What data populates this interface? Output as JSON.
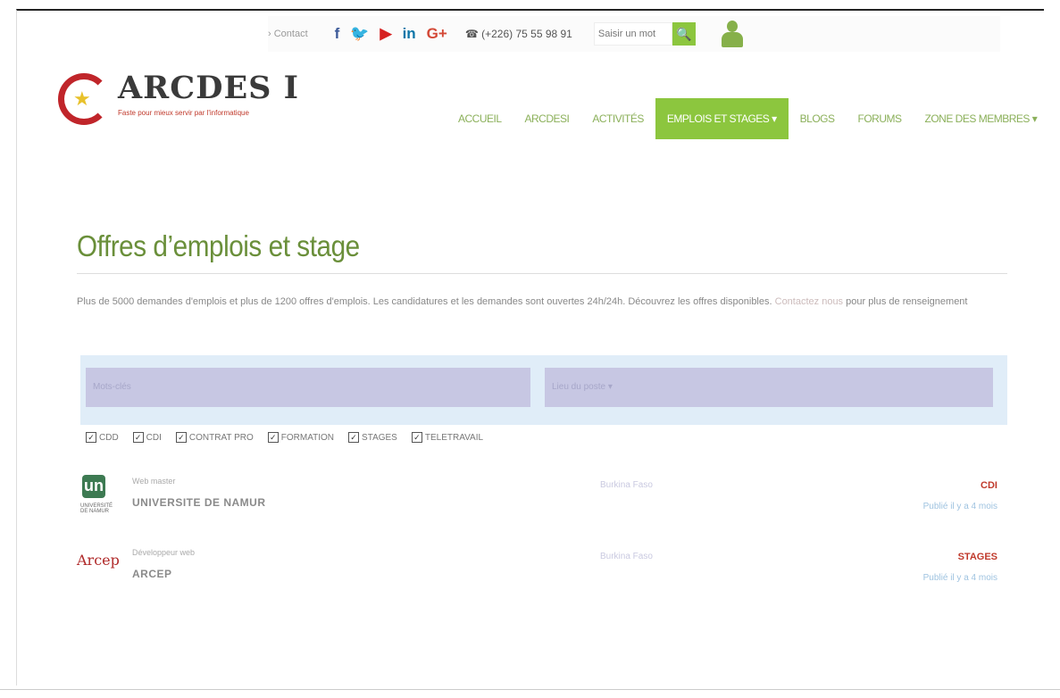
{
  "topbar": {
    "contact": "› Contact",
    "social": {
      "facebook": "f",
      "twitter": "✨",
      "youtube": "▶",
      "linkedin": "in",
      "googleplus": "G+"
    },
    "phone": "☎ (+226) 75 55 98 91",
    "search_placeholder": "Saisir un mot",
    "search_icon": "🔍"
  },
  "logo": {
    "title": "ARCDES I",
    "tagline": "Faste pour mieux servir par l'informatique"
  },
  "nav": {
    "items": [
      "ACCUEIL",
      "ARCDESI",
      "ACTIVITÉS",
      "EMPLOIS ET STAGES ▾",
      "BLOGS",
      "FORUMS",
      "ZONE DES MEMBRES ▾"
    ]
  },
  "content": {
    "title": "Offres d’emplois et stage",
    "intro_text": "Plus de 5000 demandes d'emplois et plus de 1200 offres d'emplois. Les candidatures et les demandes sont ouvertes 24h/24h. Découvrez les offres disponibles.",
    "intro_link": "Contactez nous",
    "intro_end": " pour plus de renseignement"
  },
  "filters": {
    "keywords_placeholder": "Mots-clés",
    "location_placeholder": "Lieu du poste ▾",
    "checkboxes": [
      "CDD",
      "CDI",
      "CONTRAT PRO",
      "FORMATION",
      "STAGES",
      "TELETRAVAIL"
    ]
  },
  "jobs": [
    {
      "title": "Web master",
      "company": "UNIVERSITE DE NAMUR",
      "location": "Burkina Faso",
      "type": "CDI",
      "posted": "Publié il y a 4 mois",
      "logo_text": "un",
      "logo_sub": "UNIVERSITÉ DE NAMUR"
    },
    {
      "title": "Développeur web",
      "company": "ARCEP",
      "location": "Burkina Faso",
      "type": "STAGES",
      "posted": "Publié il y a 4 mois",
      "logo_text": "Arcep"
    }
  ]
}
